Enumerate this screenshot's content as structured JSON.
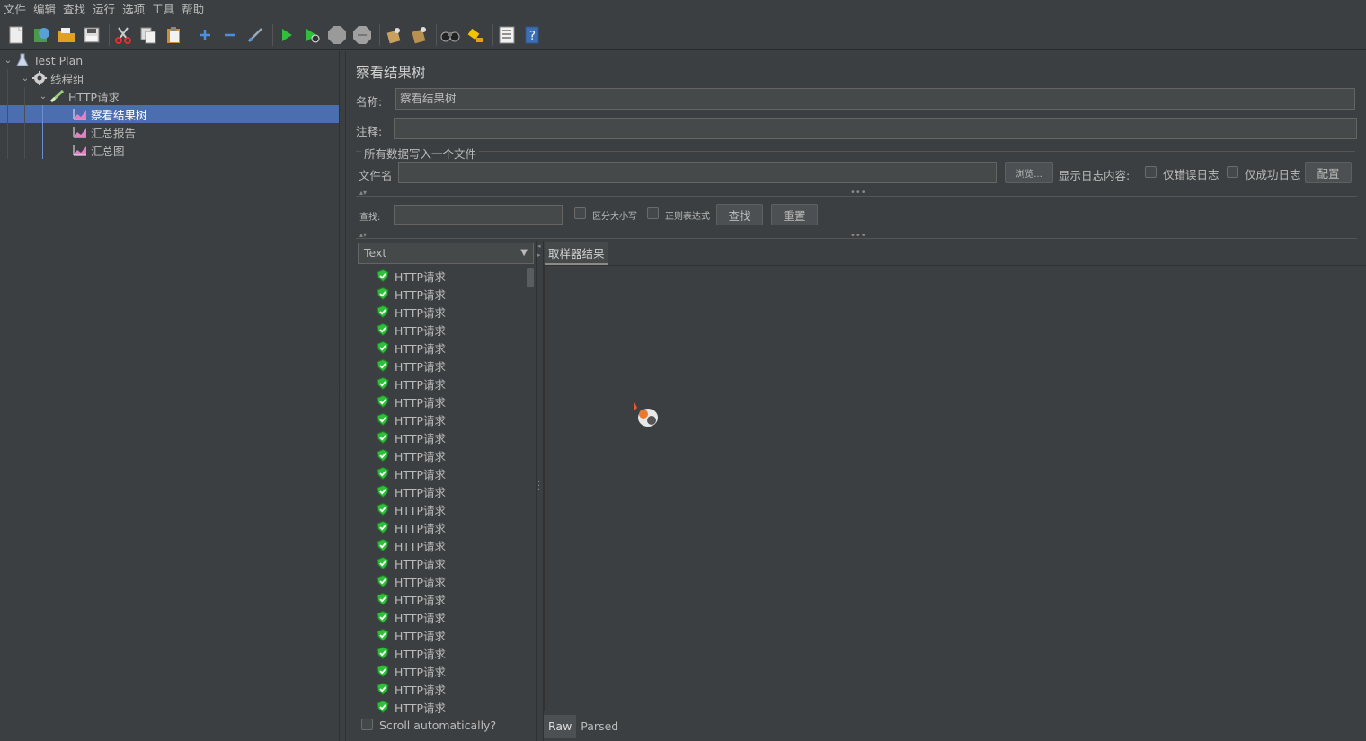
{
  "menu": [
    "文件",
    "编辑",
    "查找",
    "运行",
    "选项",
    "工具",
    "帮助"
  ],
  "toolbar": [
    "new-icon",
    "templates-icon",
    "open-icon",
    "save-icon",
    "cut-icon",
    "copy-icon",
    "paste-icon",
    "expand-icon",
    "collapse-icon",
    "toggle-icon",
    "start-icon",
    "start-no-pause-icon",
    "stop-icon",
    "shutdown-icon",
    "clear-icon",
    "clear-all-icon",
    "search-icon",
    "reset-search-icon",
    "function-helper-icon",
    "help-icon"
  ],
  "tree": {
    "test_plan": "Test Plan",
    "thread_group": "线程组",
    "http_request": "HTTP请求",
    "view_results_tree": "察看结果树",
    "summary_report": "汇总报告",
    "summary_graph": "汇总图"
  },
  "panel": {
    "title": "察看结果树",
    "name_label": "名称:",
    "name_value": "察看结果树",
    "comment_label": "注释:",
    "comment_value": "",
    "file_section": "所有数据写入一个文件",
    "filename_label": "文件名",
    "filename_value": "",
    "browse": "浏览...",
    "log_content_label": "显示日志内容:",
    "errors_only": "仅错误日志",
    "success_only": "仅成功日志",
    "configure": "配置"
  },
  "search": {
    "label": "查找:",
    "value": "",
    "case_sensitive": "区分大小写",
    "regex": "正则表达式",
    "find": "查找",
    "reset": "重置"
  },
  "results": {
    "renderer": "Text",
    "items": [
      "HTTP请求",
      "HTTP请求",
      "HTTP请求",
      "HTTP请求",
      "HTTP请求",
      "HTTP请求",
      "HTTP请求",
      "HTTP请求",
      "HTTP请求",
      "HTTP请求",
      "HTTP请求",
      "HTTP请求",
      "HTTP请求",
      "HTTP请求",
      "HTTP请求",
      "HTTP请求",
      "HTTP请求",
      "HTTP请求",
      "HTTP请求",
      "HTTP请求",
      "HTTP请求",
      "HTTP请求",
      "HTTP请求",
      "HTTP请求",
      "HTTP请求"
    ],
    "scroll_auto": "Scroll automatically?",
    "sampler_tab": "取样器结果",
    "raw_tab": "Raw",
    "parsed_tab": "Parsed"
  },
  "colors": {
    "background": "#3c3f41",
    "selection": "#4b6eaf",
    "success": "#2fbf3a"
  }
}
